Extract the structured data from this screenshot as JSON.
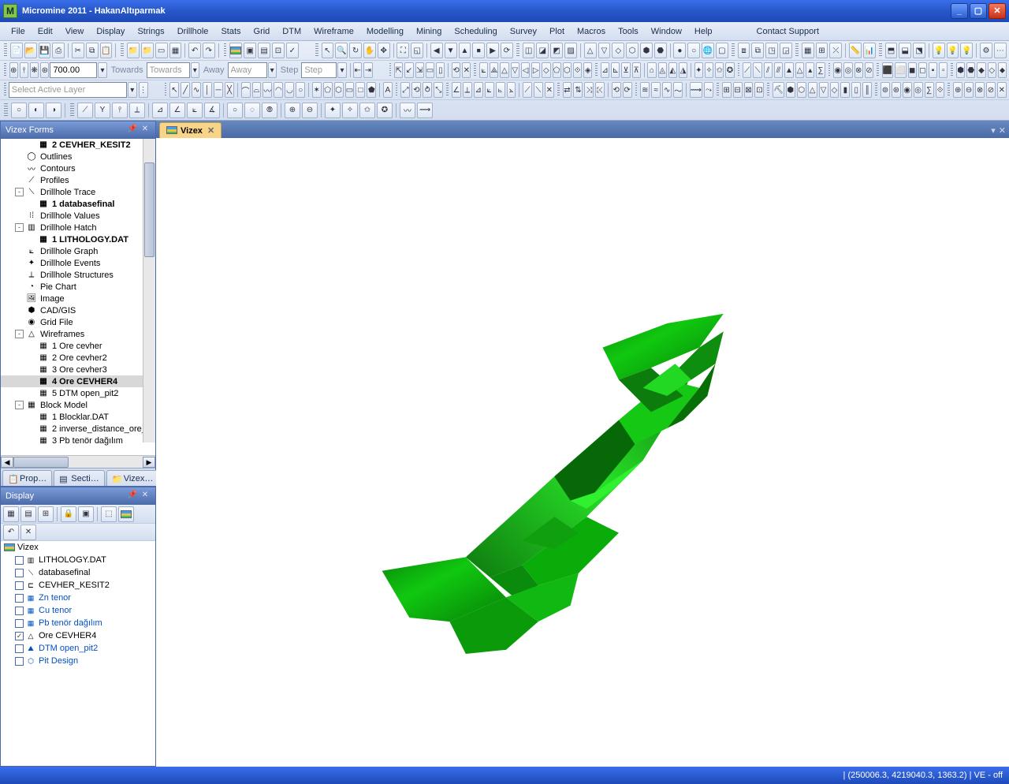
{
  "title": "Micromine 2011 - HakanAltıparmak",
  "menu": [
    "File",
    "Edit",
    "View",
    "Display",
    "Strings",
    "Drillhole",
    "Stats",
    "Grid",
    "DTM",
    "Wireframe",
    "Modelling",
    "Mining",
    "Scheduling",
    "Survey",
    "Plot",
    "Macros",
    "Tools",
    "Window",
    "Help"
  ],
  "support": "Contact Support",
  "toolbar": {
    "distance": "700.00",
    "towards_lbl": "Towards",
    "towards_val": "Towards",
    "away_lbl": "Away",
    "away_val": "Away",
    "step_lbl": "Step",
    "step_val": "Step",
    "layer_placeholder": "Select Active Layer"
  },
  "forms": {
    "title": "Vizex Forms",
    "nodes": [
      {
        "indent": 3,
        "ico": "grid",
        "bold": true,
        "label": "2 CEVHER_KESIT2"
      },
      {
        "indent": 1,
        "ico": "out",
        "label": "Outlines"
      },
      {
        "indent": 1,
        "ico": "con",
        "label": "Contours"
      },
      {
        "indent": 1,
        "ico": "pro",
        "label": "Profiles"
      },
      {
        "indent": 1,
        "exp": "-",
        "ico": "dh",
        "label": "Drillhole Trace"
      },
      {
        "indent": 3,
        "ico": "grid",
        "bold": true,
        "label": "1 databasefinal"
      },
      {
        "indent": 1,
        "ico": "17",
        "label": "Drillhole Values"
      },
      {
        "indent": 1,
        "exp": "-",
        "ico": "hat",
        "label": "Drillhole Hatch"
      },
      {
        "indent": 3,
        "ico": "grid",
        "bold": true,
        "label": "1 LITHOLOGY.DAT"
      },
      {
        "indent": 1,
        "ico": "gra",
        "label": "Drillhole Graph"
      },
      {
        "indent": 1,
        "ico": "eve",
        "label": "Drillhole Events"
      },
      {
        "indent": 1,
        "ico": "str",
        "label": "Drillhole Structures"
      },
      {
        "indent": 1,
        "ico": "pie",
        "label": "Pie Chart"
      },
      {
        "indent": 1,
        "ico": "img",
        "label": "Image"
      },
      {
        "indent": 1,
        "ico": "cad",
        "label": "CAD/GIS"
      },
      {
        "indent": 1,
        "ico": "gf",
        "label": "Grid File"
      },
      {
        "indent": 1,
        "exp": "-",
        "ico": "wf",
        "label": "Wireframes"
      },
      {
        "indent": 3,
        "ico": "grid",
        "label": "1 Ore cevher"
      },
      {
        "indent": 3,
        "ico": "grid",
        "label": "2 Ore cevher2"
      },
      {
        "indent": 3,
        "ico": "grid",
        "label": "3 Ore cevher3"
      },
      {
        "indent": 3,
        "ico": "grid",
        "bold": true,
        "sel": true,
        "label": "4 Ore CEVHER4"
      },
      {
        "indent": 3,
        "ico": "grid",
        "label": "5 DTM open_pit2"
      },
      {
        "indent": 1,
        "exp": "-",
        "ico": "bm",
        "label": "Block Model"
      },
      {
        "indent": 3,
        "ico": "grid",
        "label": "1 Blocklar.DAT"
      },
      {
        "indent": 3,
        "ico": "grid",
        "label": "2 inverse_distance_ore_"
      },
      {
        "indent": 3,
        "ico": "grid",
        "label": "3 Pb tenör dağılım"
      }
    ],
    "tabs": [
      "Prop…",
      "Secti…",
      "Vizex…"
    ]
  },
  "display": {
    "title": "Display",
    "root": "Vizex",
    "items": [
      {
        "checked": false,
        "ico": "hat",
        "label": "LITHOLOGY.DAT",
        "blue": false
      },
      {
        "checked": false,
        "ico": "dh",
        "label": "databasefinal",
        "blue": false
      },
      {
        "checked": false,
        "ico": "sec",
        "label": "CEVHER_KESIT2",
        "blue": false
      },
      {
        "checked": false,
        "ico": "bm",
        "label": "Zn tenor",
        "blue": true
      },
      {
        "checked": false,
        "ico": "bm",
        "label": "Cu tenor",
        "blue": true
      },
      {
        "checked": false,
        "ico": "bm",
        "label": "Pb tenör dağılım",
        "blue": true
      },
      {
        "checked": true,
        "ico": "wf",
        "label": "Ore CEVHER4",
        "blue": false
      },
      {
        "checked": false,
        "ico": "dtm",
        "label": "DTM open_pit2",
        "blue": true
      },
      {
        "checked": false,
        "ico": "pit",
        "label": "Pit Design",
        "blue": true
      }
    ]
  },
  "doc_tab": "Vizex",
  "status": {
    "coords": "(250006.3, 4219040.3, 1363.2)",
    "ve": "VE - off"
  }
}
